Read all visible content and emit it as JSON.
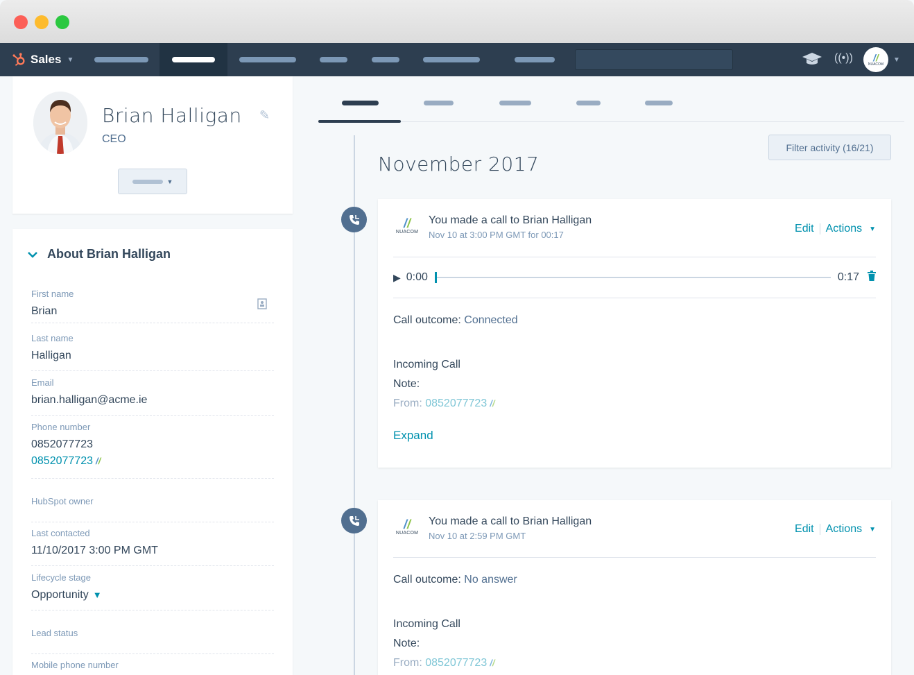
{
  "nav": {
    "brand": "Sales",
    "colors": {
      "bar": "#2d3e50",
      "accent": "#ff7a59"
    }
  },
  "profile": {
    "name": "Brian Halligan",
    "title": "CEO"
  },
  "about": {
    "heading": "About Brian Halligan",
    "fields": {
      "first_name": {
        "label": "First name",
        "value": "Brian"
      },
      "last_name": {
        "label": "Last name",
        "value": "Halligan"
      },
      "email": {
        "label": "Email",
        "value": "brian.halligan@acme.ie"
      },
      "phone": {
        "label": "Phone number",
        "value": "0852077723",
        "link_value": "0852077723"
      },
      "owner": {
        "label": "HubSpot owner",
        "value": ""
      },
      "last_contacted": {
        "label": "Last contacted",
        "value": "11/10/2017 3:00 PM GMT"
      },
      "lifecycle": {
        "label": "Lifecycle stage",
        "value": "Opportunity"
      },
      "lead_status": {
        "label": "Lead status",
        "value": ""
      },
      "mobile": {
        "label": "Mobile phone number",
        "value": ""
      }
    }
  },
  "timeline": {
    "filter_label": "Filter activity (16/21)",
    "month": "November 2017",
    "logo_text": "NUACOM",
    "cards": [
      {
        "headline_prefix": "You made a call to",
        "contact": "Brian Halligan",
        "meta": "Nov 10 at 3:00 PM GMT for 00:17",
        "edit": "Edit",
        "actions": "Actions",
        "player": {
          "start": "0:00",
          "end": "0:17",
          "progress": 0
        },
        "outcome_label": "Call outcome:",
        "outcome_value": "Connected",
        "direction": "Incoming Call",
        "note_label": "Note:",
        "from_label": "From:",
        "from_number": "0852077723",
        "expand": "Expand"
      },
      {
        "headline_prefix": "You made a call to",
        "contact": "Brian Halligan",
        "meta": "Nov 10 at 2:59 PM GMT",
        "edit": "Edit",
        "actions": "Actions",
        "outcome_label": "Call outcome:",
        "outcome_value": "No answer",
        "direction": "Incoming Call",
        "note_label": "Note:",
        "from_label": "From:",
        "from_number": "0852077723"
      }
    ]
  }
}
